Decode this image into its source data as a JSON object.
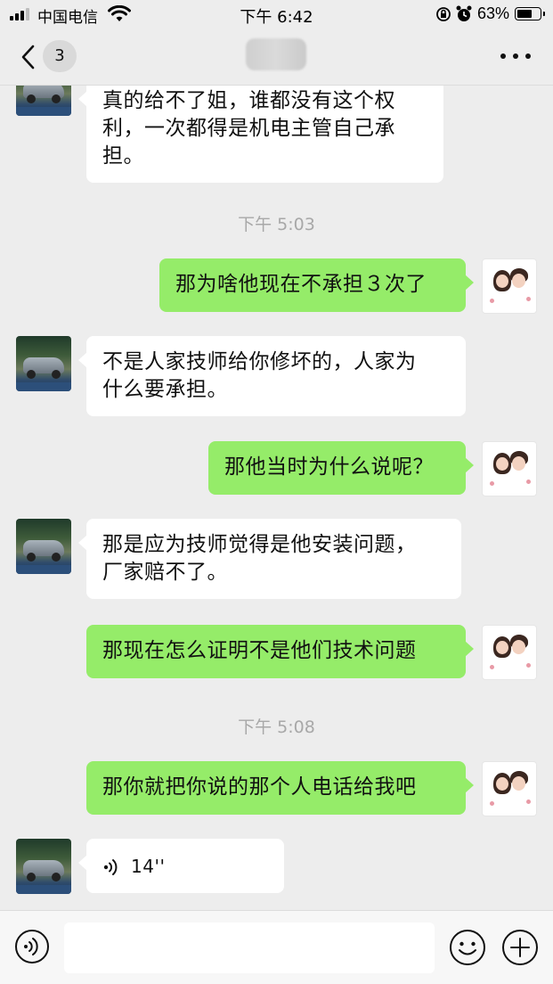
{
  "status_bar": {
    "carrier": "中国电信",
    "time": "下午 6:42",
    "battery_text": "63%",
    "battery_level": 0.63
  },
  "nav": {
    "back_badge": "3"
  },
  "messages": [
    {
      "side": "in",
      "text": "真的给不了姐，谁都没有这个权利，一次都得是机电主管自己承担。"
    },
    {
      "timestamp": "下午 5:03"
    },
    {
      "side": "out",
      "text": "那为啥他现在不承担３次了"
    },
    {
      "side": "in",
      "text": "不是人家技师给你修坏的，人家为什么要承担。"
    },
    {
      "side": "out",
      "text": "那他当时为什么说呢？"
    },
    {
      "side": "in",
      "text": "那是应为技师觉得是他安装问题，厂家赔不了。"
    },
    {
      "side": "out",
      "text": "那现在怎么证明不是他们技术问题"
    },
    {
      "timestamp": "下午 5:08"
    },
    {
      "side": "out",
      "text": "那你就把你说的那个人电话给我吧"
    },
    {
      "side": "in",
      "type": "voice",
      "duration": "14''"
    }
  ],
  "msg_lines": {
    "m0": [
      "真的给不了姐，谁都没有这个权",
      "利，一次都得是机电主管自己承",
      "担。"
    ],
    "m3": [
      "不是人家技师给你修坏的，人家为",
      "什么要承担。"
    ],
    "m5": [
      "那是应为技师觉得是他安装问题，",
      "厂家赔不了。"
    ]
  },
  "input": {
    "value": "",
    "placeholder": ""
  },
  "colors": {
    "incoming_bubble": "#ffffff",
    "outgoing_bubble": "#95ec69",
    "background": "#ededed",
    "timestamp": "#a8a8a8"
  },
  "icons": {
    "back": "chevron-left-icon",
    "more": "more-dots-icon",
    "voice_toggle": "voice-input-icon",
    "emoji": "smiley-icon",
    "plus": "plus-circle-icon",
    "voice_wave": "voice-wave-icon"
  }
}
